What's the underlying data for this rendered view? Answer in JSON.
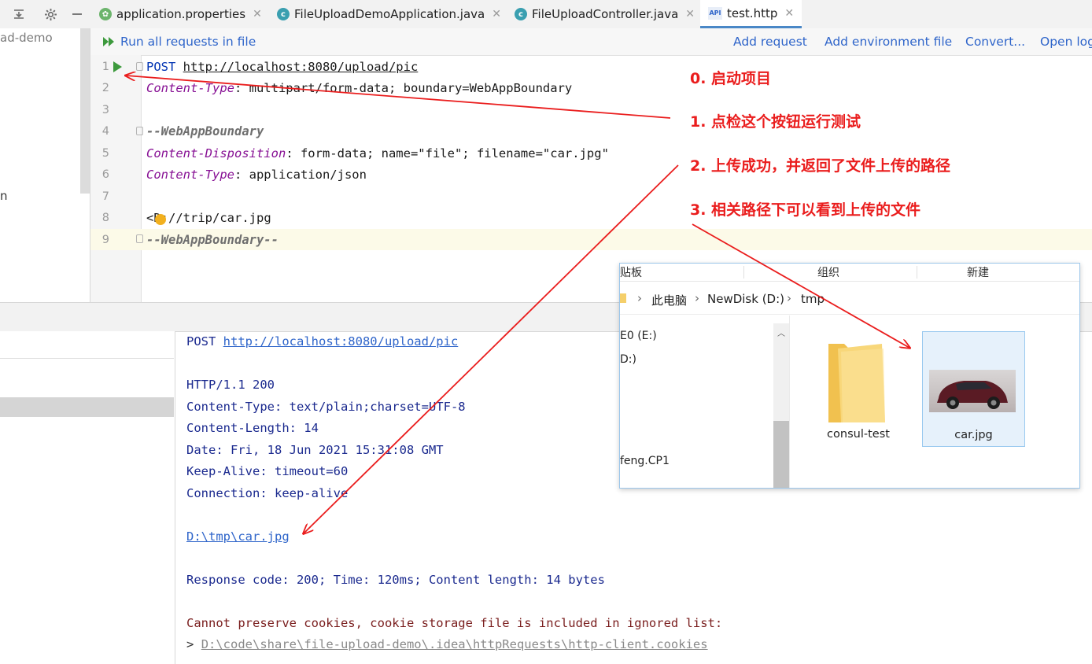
{
  "tabs": [
    {
      "label": "application.properties"
    },
    {
      "label": "FileUploadDemoApplication.java"
    },
    {
      "label": "FileUploadController.java"
    },
    {
      "label": "test.http",
      "active": true
    }
  ],
  "tab_icons": {
    "api_badge": "API",
    "class_badge": "c"
  },
  "toolbar": {
    "run_all": "Run all requests in file",
    "add_request": "Add request",
    "add_env": "Add environment file",
    "convert": "Convert...",
    "open_log": "Open log"
  },
  "project": {
    "partial_name": "ad-demo",
    "partial_item": "n"
  },
  "editor": {
    "line_numbers": [
      "1",
      "2",
      "3",
      "4",
      "5",
      "6",
      "7",
      "8",
      "9"
    ],
    "l1_method": "POST",
    "l1_url": "http://localhost:8080/upload/pic",
    "l2_key": "Content-Type",
    "l2_val": ": multipart/form-data; boundary=WebAppBoundary",
    "l4": "--WebAppBoundary",
    "l5_key": "Content-Disposition",
    "l5_val": ": form-data; name=\"file\"; filename=\"car.jpg\"",
    "l6_key": "Content-Type",
    "l6_val": ": application/json",
    "l8_lt": "<",
    "l8_rest": "D://trip/car.jpg",
    "l9": "--WebAppBoundary--"
  },
  "response": {
    "req_method": "POST",
    "req_url": "http://localhost:8080/upload/pic",
    "status": "HTTP/1.1 200",
    "ct": "Content-Type: text/plain;charset=UTF-8",
    "cl": "Content-Length: 14",
    "date": "Date: Fri, 18 Jun 2021 15:31:08 GMT",
    "keepalive": "Keep-Alive: timeout=60",
    "conn": "Connection: keep-alive",
    "body": "D:\\tmp\\car.jpg",
    "summary": "Response code: 200; Time: 120ms; Content length: 14 bytes",
    "cookie_warn": "Cannot preserve cookies, cookie storage file is included in ignored list:",
    "cookie_prefix": ">",
    "cookie_path": "D:\\code\\share\\file-upload-demo\\.idea\\httpRequests\\http-client.cookies"
  },
  "annotations": [
    "0. 启动项目",
    "1. 点检这个按钮运行测试",
    "2. 上传成功，并返回了文件上传的路径",
    "3. 相关路径下可以看到上传的文件"
  ],
  "explorer": {
    "ribbon": [
      "贴板",
      "组织",
      "新建"
    ],
    "breadcrumb": [
      "此电脑",
      "NewDisk (D:)",
      "tmp"
    ],
    "tree": [
      "E0 (E:)",
      "D:)",
      "feng.CP1"
    ],
    "files": [
      {
        "name": "consul-test"
      },
      {
        "name": "car.jpg"
      }
    ]
  },
  "colors": {
    "annotation": "#ea1d1d",
    "accent": "#2f65ca",
    "run_green": "#3d9a3d"
  }
}
